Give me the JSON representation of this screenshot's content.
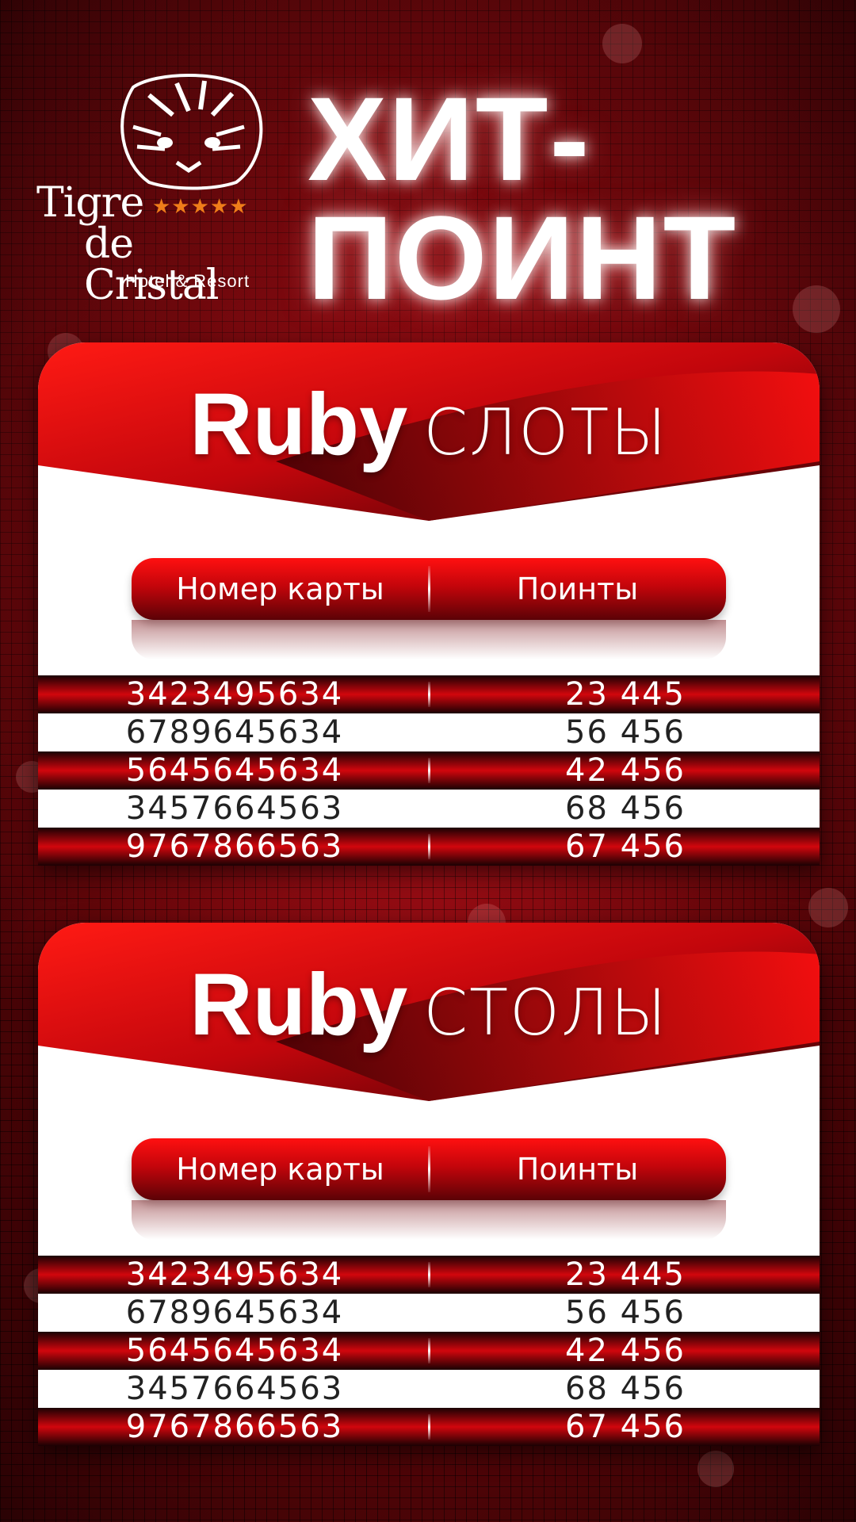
{
  "logo": {
    "icon": "tiger-head-icon",
    "name_line1": "Tigre",
    "name_line2": "de Cristal",
    "stars": "★★★★★",
    "subtitle": "Hotel & Resort"
  },
  "title": {
    "line1": "ХИТ-",
    "line2": "ПОИНТ"
  },
  "panels": [
    {
      "brand": "Ruby",
      "kind": "СЛОТЫ",
      "col_card": "Номер карты",
      "col_points": "Поинты",
      "rows": [
        {
          "card": "3423495634",
          "points": "23 445"
        },
        {
          "card": "6789645634",
          "points": "56 456"
        },
        {
          "card": "5645645634",
          "points": "42 456"
        },
        {
          "card": "3457664563",
          "points": "68 456"
        },
        {
          "card": "9767866563",
          "points": "67 456"
        }
      ]
    },
    {
      "brand": "Ruby",
      "kind": "СТОЛЫ",
      "col_card": "Номер карты",
      "col_points": "Поинты",
      "rows": [
        {
          "card": "3423495634",
          "points": "23 445"
        },
        {
          "card": "6789645634",
          "points": "56 456"
        },
        {
          "card": "5645645634",
          "points": "42 456"
        },
        {
          "card": "3457664563",
          "points": "68 456"
        },
        {
          "card": "9767866563",
          "points": "67 456"
        }
      ]
    }
  ]
}
